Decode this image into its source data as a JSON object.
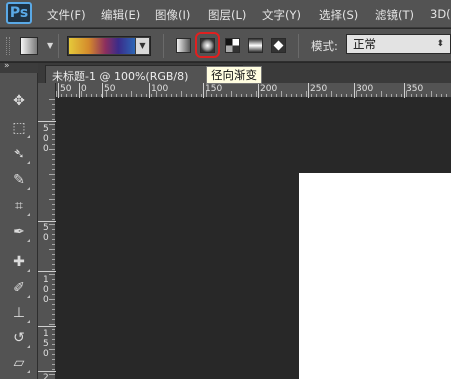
{
  "app": {
    "logo": "Ps"
  },
  "menu": [
    {
      "label": "文件(F)"
    },
    {
      "label": "编辑(E)"
    },
    {
      "label": "图像(I)"
    },
    {
      "label": "图层(L)"
    },
    {
      "label": "文字(Y)"
    },
    {
      "label": "选择(S)"
    },
    {
      "label": "滤镜(T)"
    },
    {
      "label": "3D("
    }
  ],
  "options_bar": {
    "tool_preset_icon": "gradient-tool-preset-icon",
    "gradient_types": [
      {
        "name": "linear-gradient-icon"
      },
      {
        "name": "radial-gradient-icon",
        "selected": true
      },
      {
        "name": "angle-gradient-icon"
      },
      {
        "name": "reflected-gradient-icon"
      },
      {
        "name": "diamond-gradient-icon"
      }
    ],
    "mode_label": "模式:",
    "mode_value": "正常",
    "highlight_color": "#e02020"
  },
  "tooltip": {
    "text": "径向渐变"
  },
  "tools": [
    {
      "name": "move-tool-icon",
      "glyph": "✥"
    },
    {
      "name": "marquee-tool-icon",
      "glyph": "⬚"
    },
    {
      "name": "lasso-tool-icon",
      "glyph": "⌒"
    },
    {
      "name": "quick-selection-tool-icon",
      "glyph": "✎"
    },
    {
      "name": "crop-tool-icon",
      "glyph": "⌗"
    },
    {
      "name": "eyedropper-tool-icon",
      "glyph": "✒"
    },
    {
      "name": "healing-brush-tool-icon",
      "glyph": "✚"
    },
    {
      "name": "brush-tool-icon",
      "glyph": "✐"
    },
    {
      "name": "clone-stamp-tool-icon",
      "glyph": "⊥"
    },
    {
      "name": "history-brush-tool-icon",
      "glyph": "↺"
    },
    {
      "name": "eraser-tool-icon",
      "glyph": "▱"
    }
  ],
  "document": {
    "tab_title": "未标题-1 @ 100%(RGB/8)",
    "close_glyph": "×"
  },
  "rulers": {
    "horizontal_labels": [
      "50",
      "0",
      "50",
      "100",
      "150",
      "200",
      "250",
      "300",
      "350"
    ],
    "vertical_labels": [
      "5",
      "0",
      "0",
      "5",
      "0",
      "1",
      "0",
      "0",
      "1",
      "5",
      "0",
      "2"
    ]
  },
  "colors": {
    "ui_bg": "#535353",
    "canvas_bg": "#282828",
    "document_bg": "#ffffff",
    "accent_logo": "#5aa9e6"
  }
}
